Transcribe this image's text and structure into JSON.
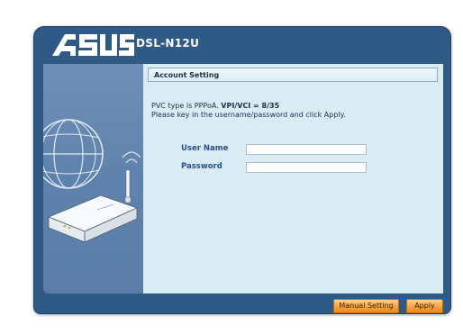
{
  "header": {
    "brand": "ASUS",
    "model": "DSL-N12U"
  },
  "main": {
    "section_title": "Account Setting",
    "pvc_text_pre": "PVC type is PPPoA. ",
    "pvc_text_bold": "VPI/VCI = 8/35",
    "instruction": "Please key in the username/password and click Apply.",
    "username_label": "User Name",
    "username_value": "",
    "password_label": "Password",
    "password_value": ""
  },
  "buttons": {
    "manual_setting": "Manual Setting",
    "apply": "Apply"
  },
  "colors": {
    "frame": "#2f5a86",
    "content_bg": "#d9ebf3",
    "button": "#f5a343"
  }
}
